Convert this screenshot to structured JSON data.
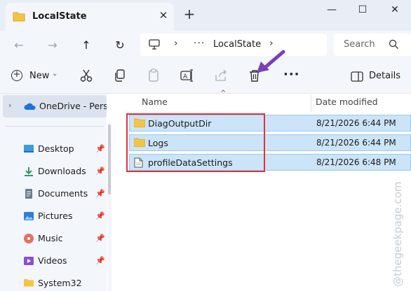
{
  "window": {
    "tab_title": "LocalState",
    "new_tab_symbol": "+",
    "close_tab_symbol": "✕",
    "controls": {
      "minimize": "—",
      "maximize": "☐",
      "close": "✕"
    }
  },
  "navigation": {
    "back": "←",
    "forward": "→",
    "up": "↑",
    "refresh": "↻",
    "address": {
      "overflow": "···",
      "crumb": "LocalState",
      "separator": "›"
    },
    "search_placeholder": "Search"
  },
  "toolbar": {
    "new_label": "New",
    "details_label": "Details",
    "more_symbol": "···",
    "icons": [
      "cut-icon",
      "copy-icon",
      "paste-icon",
      "rename-icon",
      "share-icon",
      "delete-icon"
    ]
  },
  "sidebar": {
    "onedrive_label": "OneDrive - Person",
    "items": [
      {
        "label": "Desktop",
        "icon": "desktop-icon",
        "pinned": true
      },
      {
        "label": "Downloads",
        "icon": "downloads-icon",
        "pinned": true
      },
      {
        "label": "Documents",
        "icon": "documents-icon",
        "pinned": true
      },
      {
        "label": "Pictures",
        "icon": "pictures-icon",
        "pinned": true
      },
      {
        "label": "Music",
        "icon": "music-icon",
        "pinned": true
      },
      {
        "label": "Videos",
        "icon": "videos-icon",
        "pinned": true
      },
      {
        "label": "System32",
        "icon": "folder-icon",
        "pinned": false
      }
    ],
    "pin_symbol": "📌"
  },
  "file_list": {
    "columns": {
      "name": "Name",
      "date": "Date modified"
    },
    "sort_indicator": "^",
    "rows": [
      {
        "name": "DiagOutputDir",
        "date": "8/21/2026 6:44 PM",
        "type": "folder",
        "selected": true
      },
      {
        "name": "Logs",
        "date": "8/21/2026 6:44 PM",
        "type": "folder",
        "selected": true
      },
      {
        "name": "profileDataSettings",
        "date": "8/21/2026 6:48 PM",
        "type": "file",
        "selected": true
      }
    ]
  },
  "watermark": "@thegeekpage.com",
  "colors": {
    "selection": "#cce4f7",
    "highlight_border": "#e2313b",
    "arrow": "#7b3fb8",
    "folder": "#f5c542"
  }
}
